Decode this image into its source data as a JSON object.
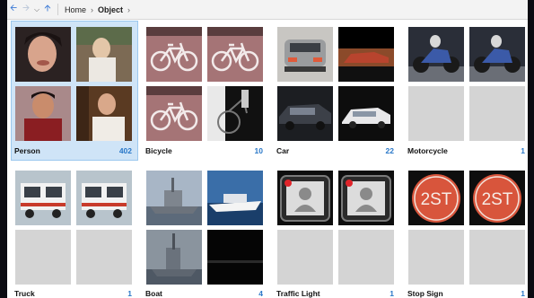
{
  "breadcrumb": {
    "home": "Home",
    "current": "Object"
  },
  "nav": {
    "back_icon": "arrow-left-icon",
    "forward_icon": "arrow-right-icon",
    "up_icon": "arrow-up-icon",
    "chevron": "chevron-right-icon"
  },
  "colors": {
    "selected_bg": "#cfe4f7",
    "count_color": "#2a78c8",
    "placeholder": "#d4d4d4"
  },
  "categories": [
    {
      "name": "Person",
      "count": "402",
      "selected": true
    },
    {
      "name": "Bicycle",
      "count": "10"
    },
    {
      "name": "Car",
      "count": "22"
    },
    {
      "name": "Motorcycle",
      "count": "1"
    },
    {
      "name": "Truck",
      "count": "1"
    },
    {
      "name": "Boat",
      "count": "4"
    },
    {
      "name": "Traffic Light",
      "count": "1"
    },
    {
      "name": "Stop Sign",
      "count": "1"
    }
  ]
}
